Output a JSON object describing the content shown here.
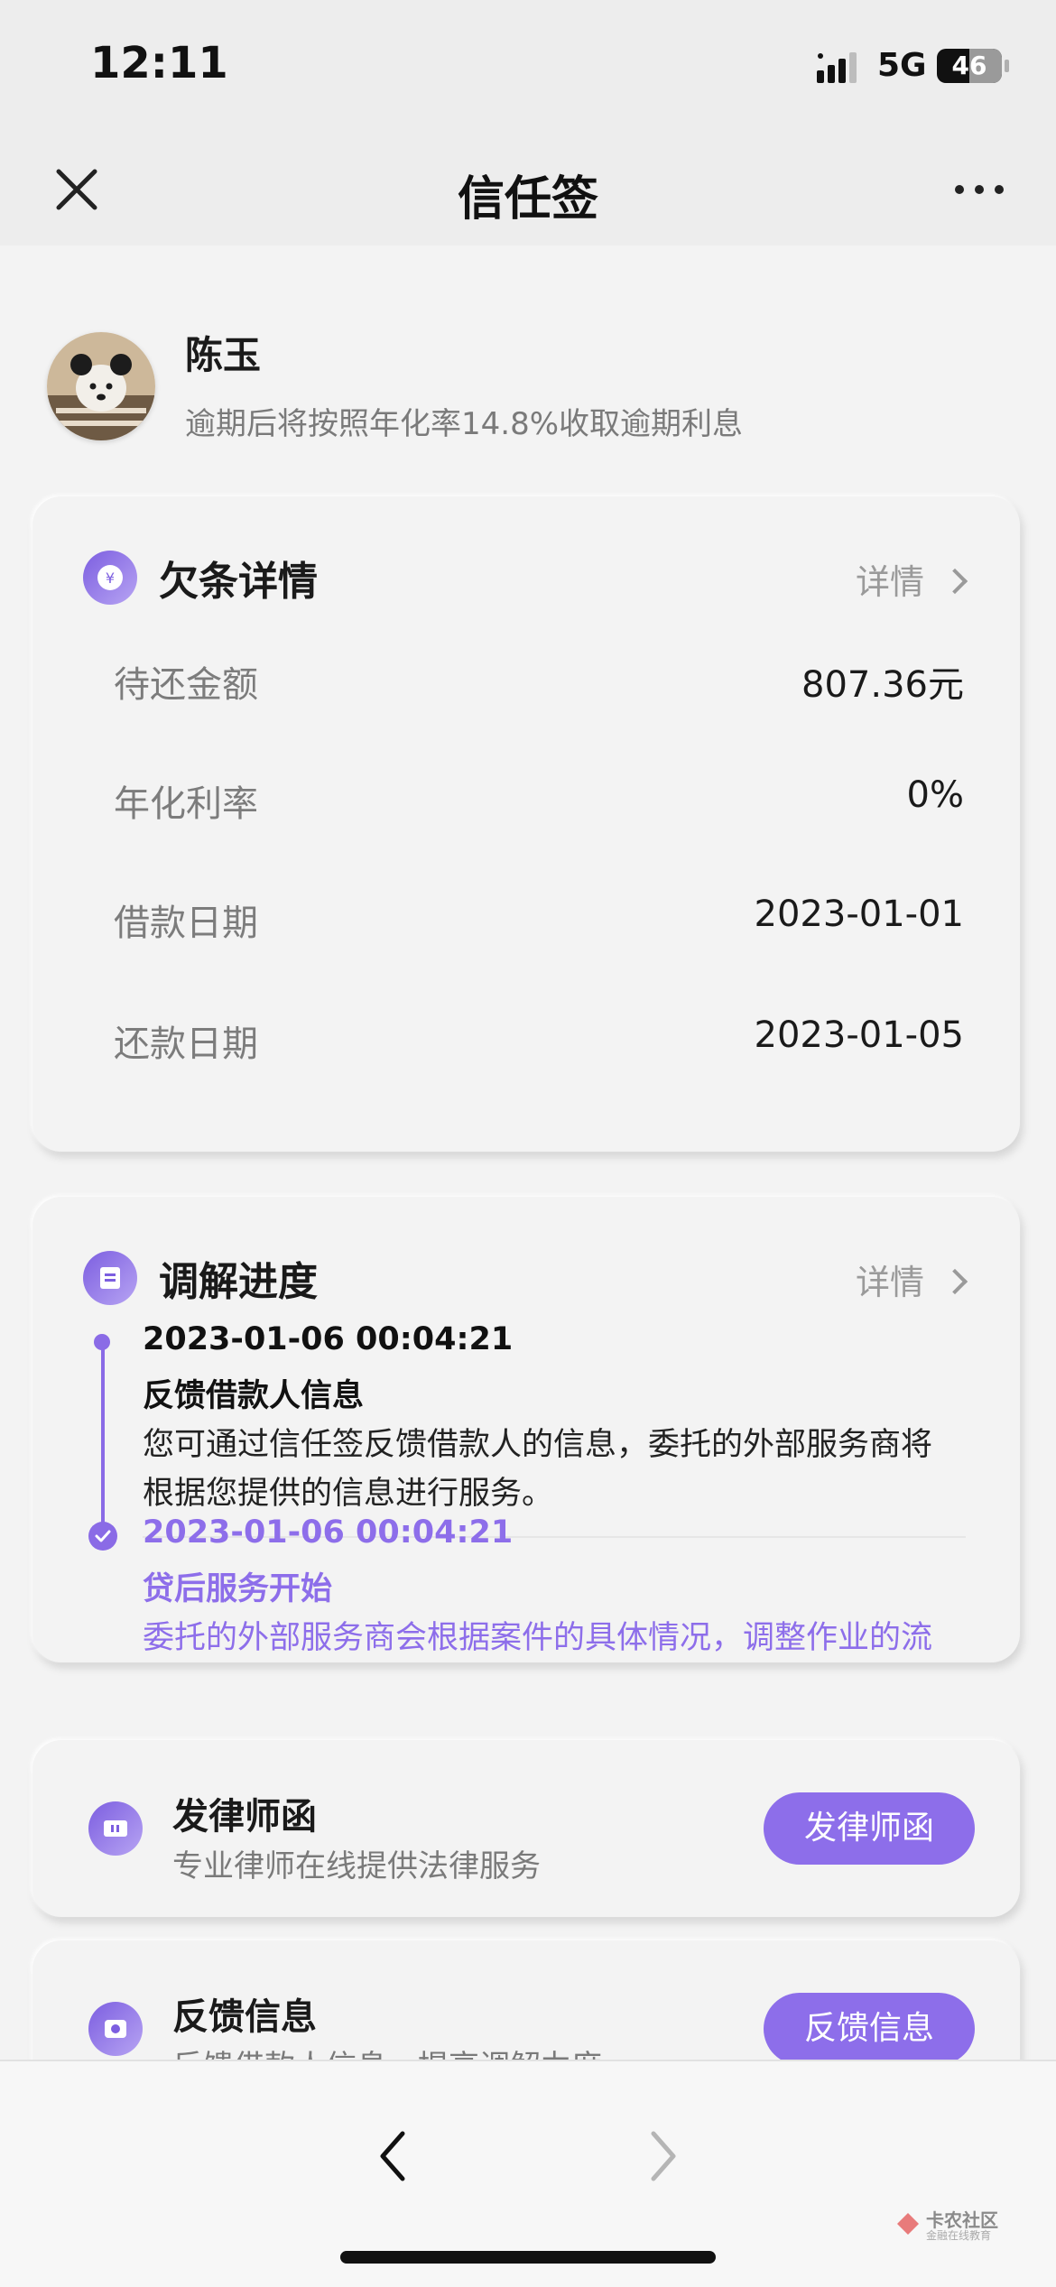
{
  "status_bar": {
    "time": "12:11",
    "network": "5G",
    "battery": "46"
  },
  "nav": {
    "title": "信任签"
  },
  "profile": {
    "name": "陈玉",
    "note": "逾期后将按照年化率14.8%收取逾期利息"
  },
  "debt_card": {
    "title": "欠条详情",
    "detail_link": "详情",
    "rows": [
      {
        "label": "待还金额",
        "value": "807.36元"
      },
      {
        "label": "年化利率",
        "value": "0%"
      },
      {
        "label": "借款日期",
        "value": "2023-01-01"
      },
      {
        "label": "还款日期",
        "value": "2023-01-05"
      }
    ]
  },
  "mediation_card": {
    "title": "调解进度",
    "detail_link": "详情",
    "events": [
      {
        "time": "2023-01-06 00:04:21",
        "title": "反馈借款人信息",
        "desc_line1": "您可通过信任签反馈借款人的信息，委托的外部服务商将",
        "desc_line2": "根据您提供的信息进行服务。"
      },
      {
        "time": "2023-01-06 00:04:21",
        "title": "贷后服务开始",
        "desc_line1": "委托的外部服务商会根据案件的具体情况，调整作业的流"
      }
    ]
  },
  "services": [
    {
      "title": "发律师函",
      "subtitle": "专业律师在线提供法律服务",
      "button": "发律师函"
    },
    {
      "title": "反馈信息",
      "subtitle": "反馈借款人信息，提高调解力度",
      "button": "反馈信息"
    }
  ],
  "watermark": {
    "title": "卡农社区",
    "subtitle": "金融在线教育"
  },
  "colors": {
    "accent": "#8d6eea",
    "page_bg": "#f3f3f3",
    "muted_text": "#7a7a7a"
  }
}
